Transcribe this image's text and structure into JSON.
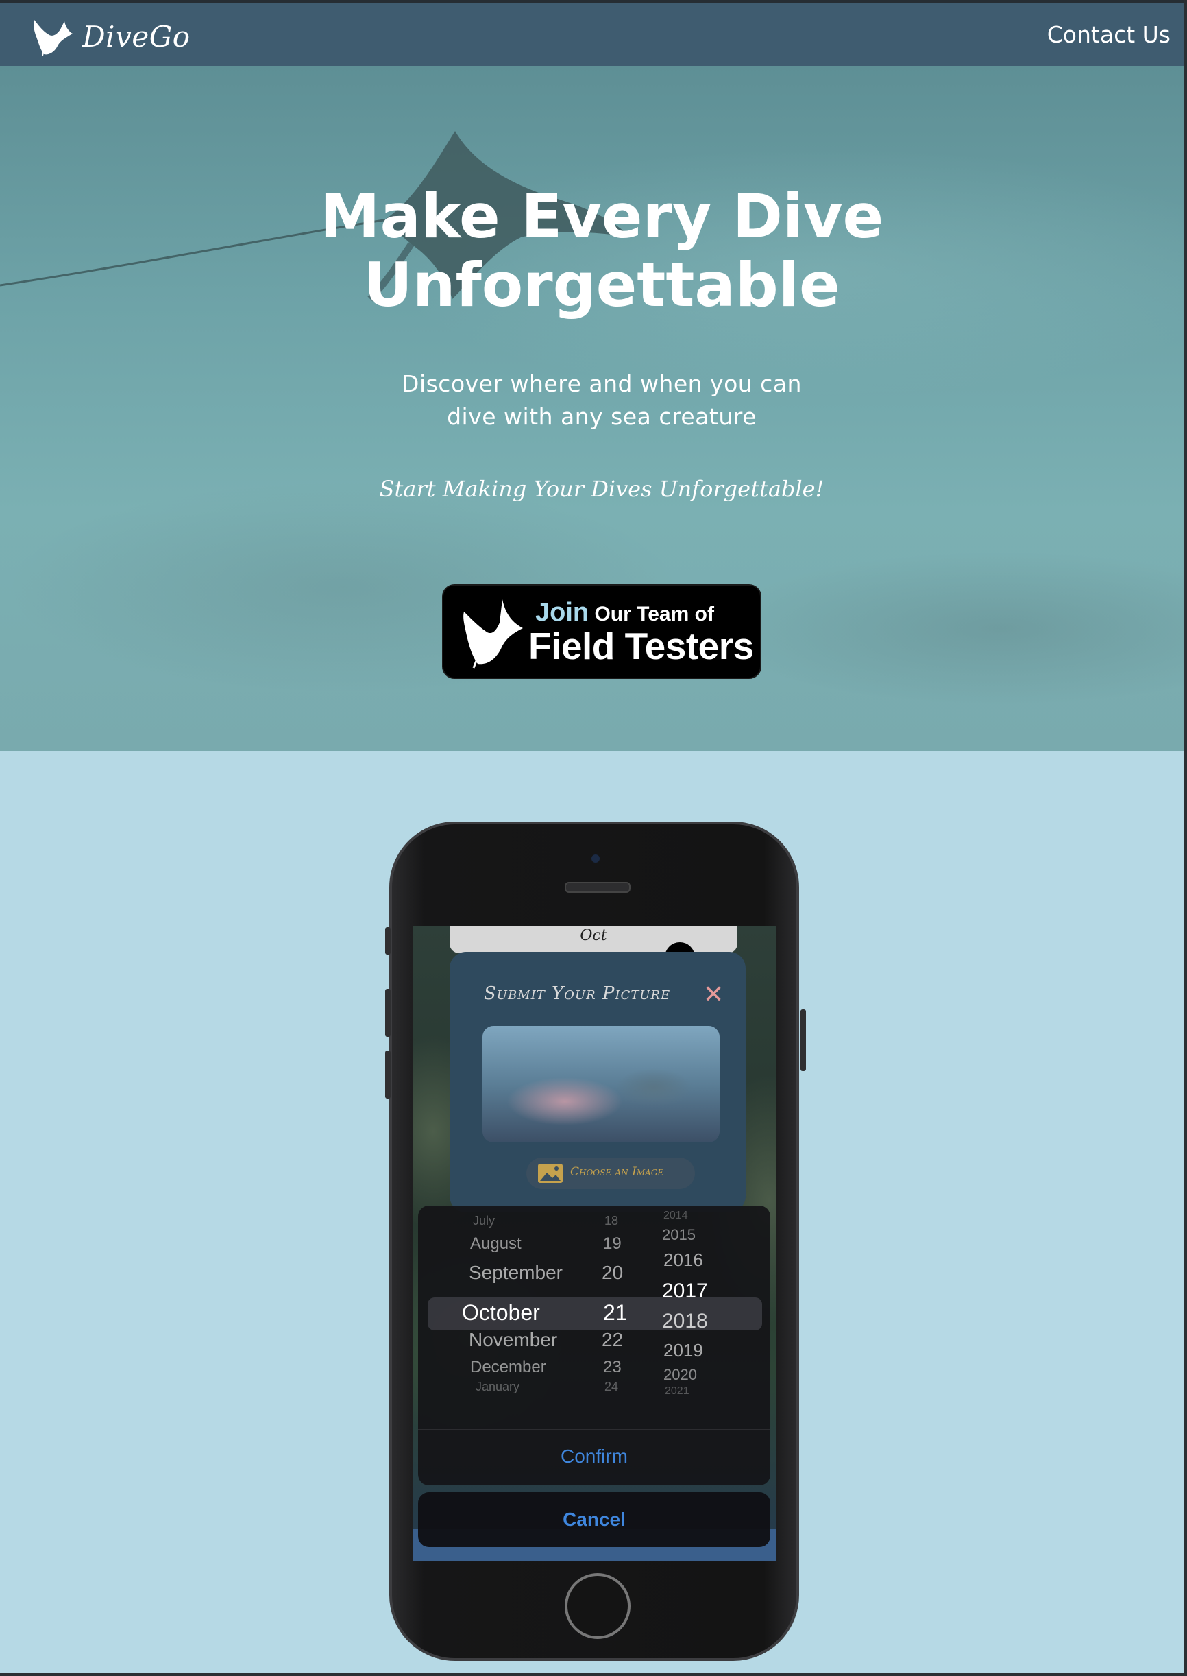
{
  "nav": {
    "brand": "DiveGo",
    "contact_label": "Contact Us"
  },
  "hero": {
    "title_line1": "Make Every Dive",
    "title_line2": "Unforgettable",
    "subtitle_line1": "Discover where and when you can",
    "subtitle_line2": "dive with any sea creature",
    "tagline": "Start Making Your Dives Unforgettable!",
    "cta": {
      "join": "Join",
      "rest": "Our Team of",
      "line2": "Field Testers"
    }
  },
  "phone_screen": {
    "month_strip": "Oct",
    "modal": {
      "title": "Submit Your Picture",
      "close": "✕",
      "choose_label": "Choose an Image"
    },
    "picker": {
      "months": [
        "July",
        "August",
        "September",
        "October",
        "November",
        "December",
        "January"
      ],
      "days": [
        "18",
        "19",
        "20",
        "21",
        "22",
        "23",
        "24"
      ],
      "years": [
        "2014",
        "2015",
        "2016",
        "2017",
        "2018",
        "2019",
        "2020",
        "2021"
      ],
      "selected_month": "October",
      "selected_day": "21",
      "selected_year": "2017",
      "confirm_label": "Confirm",
      "cancel_label": "Cancel"
    }
  },
  "colors": {
    "nav_bg": "#3f5c70",
    "lower_bg": "#b6d9e5",
    "cta_join": "#a9d9ec",
    "ios_blue": "#3f86dd"
  },
  "icons": {
    "brand": "manta-ray-icon",
    "cta": "manta-ray-icon",
    "close": "close-icon",
    "image": "image-icon"
  }
}
